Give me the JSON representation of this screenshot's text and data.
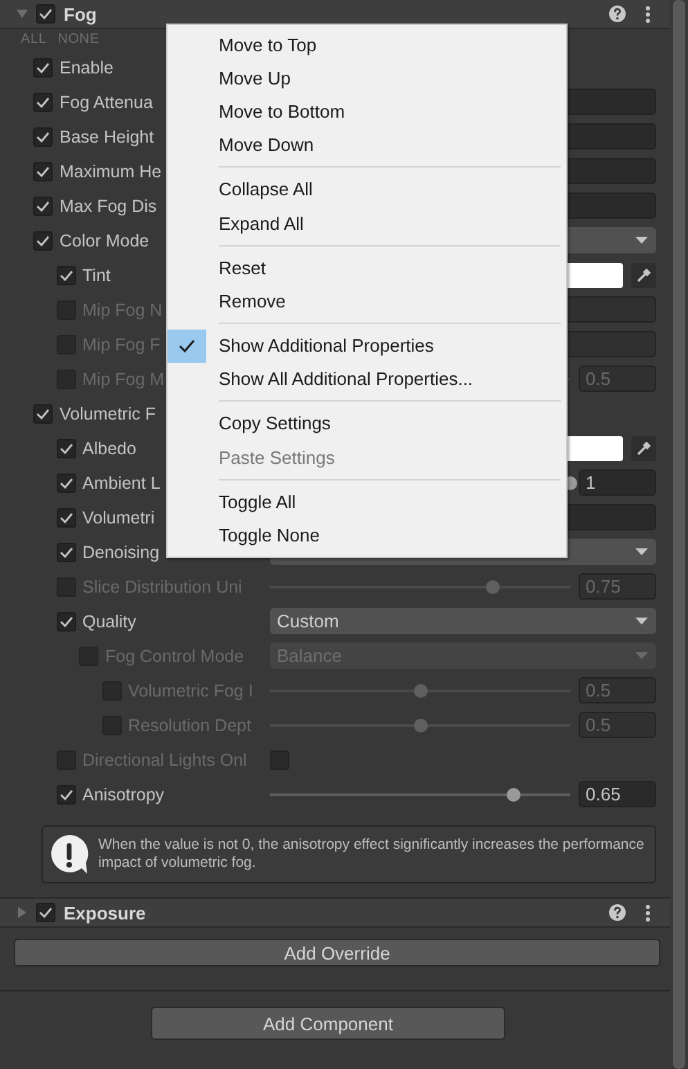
{
  "components": [
    {
      "title": "Fog",
      "expanded": true,
      "enabled": true,
      "all_label": "ALL",
      "none_label": "NONE",
      "properties": [
        {
          "label": "Enable",
          "checked": true,
          "disabled": false,
          "kind": "none"
        },
        {
          "label": "Fog Attenua",
          "checked": true,
          "disabled": false,
          "kind": "field"
        },
        {
          "label": "Base Height",
          "checked": true,
          "disabled": false,
          "kind": "field"
        },
        {
          "label": "Maximum He",
          "checked": true,
          "disabled": false,
          "kind": "field"
        },
        {
          "label": "Max Fog Dis",
          "checked": true,
          "disabled": false,
          "kind": "field"
        },
        {
          "label": "Color Mode",
          "checked": true,
          "disabled": false,
          "kind": "dropdown",
          "children": [
            {
              "label": "Tint",
              "checked": true,
              "disabled": false,
              "kind": "color",
              "color": "#ffffff"
            },
            {
              "label": "Mip Fog N",
              "checked": false,
              "disabled": true,
              "kind": "field"
            },
            {
              "label": "Mip Fog F",
              "checked": false,
              "disabled": true,
              "kind": "field"
            },
            {
              "label": "Mip Fog M",
              "checked": false,
              "disabled": true,
              "kind": "slider",
              "value": "0.5"
            }
          ]
        },
        {
          "label": "Volumetric F",
          "checked": true,
          "disabled": false,
          "kind": "none",
          "children": [
            {
              "label": "Albedo",
              "checked": true,
              "disabled": false,
              "kind": "color",
              "color": "#ffffff"
            },
            {
              "label": "Ambient L",
              "checked": true,
              "disabled": false,
              "kind": "slider",
              "level": 1,
              "value": "1"
            },
            {
              "label": "Volumetri",
              "checked": true,
              "disabled": false,
              "kind": "field"
            },
            {
              "label": "Denoising",
              "checked": true,
              "disabled": false,
              "kind": "dropdown"
            },
            {
              "label": "Slice Distribution Uni",
              "checked": false,
              "disabled": true,
              "kind": "slider",
              "level": 0.74,
              "value": "0.75"
            },
            {
              "label": "Quality",
              "checked": true,
              "disabled": false,
              "kind": "dropdown",
              "value": "Custom",
              "children": [
                {
                  "label": "Fog Control Mode",
                  "checked": false,
                  "disabled": true,
                  "kind": "dropdown",
                  "value": "Balance",
                  "children": [
                    {
                      "label": "Volumetric Fog I",
                      "checked": false,
                      "disabled": true,
                      "kind": "slider",
                      "level": 0.5,
                      "value": "0.5"
                    },
                    {
                      "label": "Resolution Dept",
                      "checked": false,
                      "disabled": true,
                      "kind": "slider",
                      "level": 0.5,
                      "value": "0.5"
                    }
                  ]
                }
              ]
            },
            {
              "label": "Directional Lights Onl",
              "checked": false,
              "disabled": true,
              "kind": "toggle",
              "on": false
            },
            {
              "label": "Anisotropy",
              "checked": true,
              "disabled": false,
              "kind": "slider",
              "level": 0.81,
              "value": "0.65"
            }
          ]
        }
      ],
      "message": "When the value is not 0, the anisotropy effect significantly increases the performance impact of volumetric fog."
    },
    {
      "title": "Exposure",
      "expanded": false,
      "enabled": true
    }
  ],
  "add_override": "Add Override",
  "add_component": "Add Component",
  "context_menu": {
    "groups": [
      [
        {
          "label": "Move to Top",
          "checked": false,
          "disabled": false
        },
        {
          "label": "Move Up",
          "checked": false,
          "disabled": false
        },
        {
          "label": "Move to Bottom",
          "checked": false,
          "disabled": false
        },
        {
          "label": "Move Down",
          "checked": false,
          "disabled": false
        }
      ],
      [
        {
          "label": "Collapse All",
          "checked": false,
          "disabled": false
        },
        {
          "label": "Expand All",
          "checked": false,
          "disabled": false
        }
      ],
      [
        {
          "label": "Reset",
          "checked": false,
          "disabled": false
        },
        {
          "label": "Remove",
          "checked": false,
          "disabled": false
        }
      ],
      [
        {
          "label": "Show Additional Properties",
          "checked": true,
          "disabled": false
        },
        {
          "label": "Show All Additional Properties...",
          "checked": false,
          "disabled": false
        }
      ],
      [
        {
          "label": "Copy Settings",
          "checked": false,
          "disabled": false
        },
        {
          "label": "Paste Settings",
          "checked": false,
          "disabled": true
        }
      ],
      [
        {
          "label": "Toggle All",
          "checked": false,
          "disabled": false
        },
        {
          "label": "Toggle None",
          "checked": false,
          "disabled": false
        }
      ]
    ]
  }
}
